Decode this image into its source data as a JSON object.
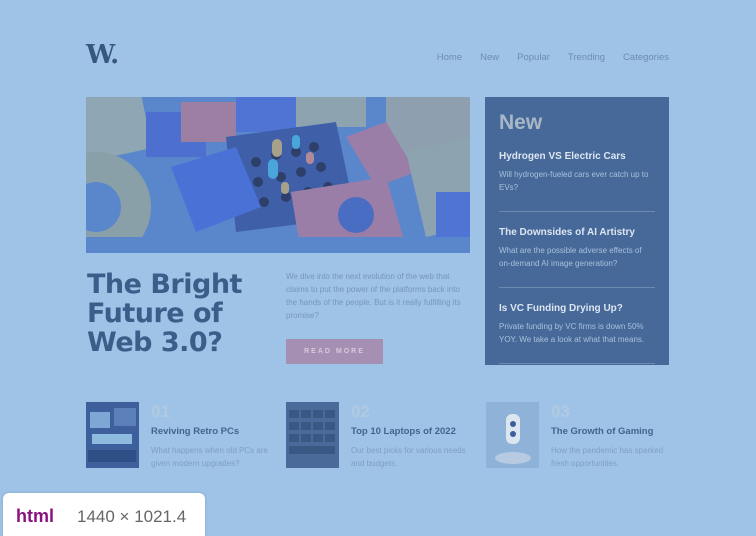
{
  "header": {
    "logo": "W.",
    "nav": [
      "Home",
      "New",
      "Popular",
      "Trending",
      "Categories"
    ]
  },
  "main": {
    "headline": "The Bright Future of Web 3.0?",
    "description": "We dive into the next evolution of the web that claims to put the power of the platforms back into the hands of the people. But is it really fulfilling its promise?",
    "read_more": "READ MORE"
  },
  "new_panel": {
    "title": "New",
    "items": [
      {
        "title": "Hydrogen VS Electric Cars",
        "desc": "Will hydrogen-fueled cars ever catch up to EVs?"
      },
      {
        "title": "The Downsides of AI Artistry",
        "desc": "What are the possible adverse effects of on-demand AI image generation?"
      },
      {
        "title": "Is VC Funding Drying Up?",
        "desc": "Private funding by VC firms is down 50% YOY. We take a look at what that means."
      }
    ]
  },
  "bottom": [
    {
      "num": "01",
      "title": "Reviving Retro PCs",
      "desc": "What happens when old PCs are given modern upgrades?"
    },
    {
      "num": "02",
      "title": "Top 10 Laptops of 2022",
      "desc": "Our best picks for various needs and budgets."
    },
    {
      "num": "03",
      "title": "The Growth of Gaming",
      "desc": "How the pandemic has sparked fresh opportunities."
    }
  ],
  "tooltip": {
    "tag": "html",
    "dims": "1440 × 1021.4"
  },
  "colors": {
    "overlay": "#9ec3e6",
    "panel": "#46699a",
    "headline": "#3a5e8a",
    "button": "#a590b3"
  }
}
